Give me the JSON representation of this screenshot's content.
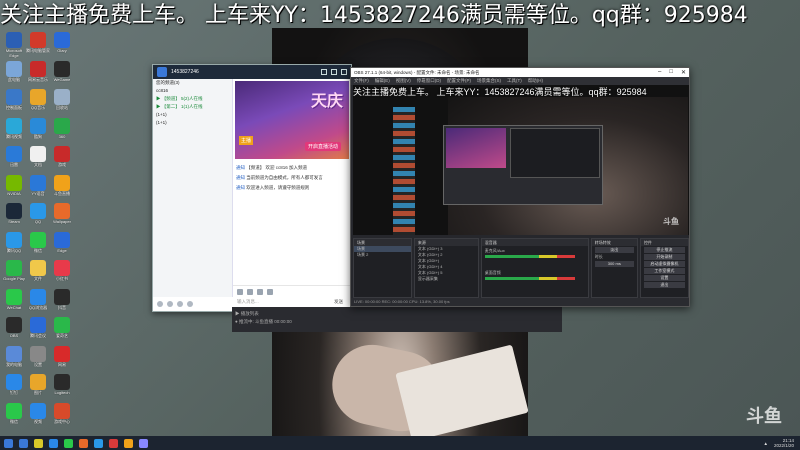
{
  "ticker": {
    "text": "关注主播免费上车。 上车来YY：1453827246满员需等位。qq群：925984"
  },
  "desktop_icons": [
    {
      "label": "Microsoft Edge",
      "color": "#2b5fb4"
    },
    {
      "label": "腾讯电脑管家",
      "color": "#d23a2a"
    },
    {
      "label": "Glary",
      "color": "#2a6ad8"
    },
    {
      "label": "此电脑",
      "color": "#7ba6d8"
    },
    {
      "label": "网易云音乐",
      "color": "#c82a2a"
    },
    {
      "label": "WeGame",
      "color": "#2a2a2a"
    },
    {
      "label": "控制面板",
      "color": "#3a78c8"
    },
    {
      "label": "QQ音乐",
      "color": "#e8a62a"
    },
    {
      "label": "回收站",
      "color": "#9ab0c8"
    },
    {
      "label": "腾讯视频",
      "color": "#2aa8d8"
    },
    {
      "label": "酷狗",
      "color": "#2a8ad8"
    },
    {
      "label": "360",
      "color": "#2aa84a"
    },
    {
      "label": "迅雷",
      "color": "#2a7ad8"
    },
    {
      "label": "文档",
      "color": "#f0f0f0"
    },
    {
      "label": "游戏",
      "color": "#c82a2a"
    },
    {
      "label": "NVIDIA",
      "color": "#76b900"
    },
    {
      "label": "YY语音",
      "color": "#2a78d8"
    },
    {
      "label": "斗鱼直播",
      "color": "#f0a21a"
    },
    {
      "label": "Steam",
      "color": "#1b2838"
    },
    {
      "label": "QQ",
      "color": "#2a98e8"
    },
    {
      "label": "Wallpaper",
      "color": "#e86a2a"
    },
    {
      "label": "腾讯QQ",
      "color": "#2a98e8"
    },
    {
      "label": "微信",
      "color": "#2ac84a"
    },
    {
      "label": "Edge",
      "color": "#2a6ad8"
    },
    {
      "label": "Google Play",
      "color": "#2ab84a"
    },
    {
      "label": "文件",
      "color": "#f0c84a"
    },
    {
      "label": "小红书",
      "color": "#e83a4a"
    },
    {
      "label": "WeChat",
      "color": "#2ac84a"
    },
    {
      "label": "QQ浏览器",
      "color": "#2a88e8"
    },
    {
      "label": "抖音",
      "color": "#2a2a2a"
    },
    {
      "label": "OBS",
      "color": "#2a2a2a"
    },
    {
      "label": "腾讯会议",
      "color": "#2a6ad8"
    },
    {
      "label": "爱奇艺",
      "color": "#2ab84a"
    },
    {
      "label": "我的电脑",
      "color": "#5a8ad8"
    },
    {
      "label": "设置",
      "color": "#888888"
    },
    {
      "label": "网易",
      "color": "#d82a2a"
    },
    {
      "label": "钉钉",
      "color": "#2a88e8"
    },
    {
      "label": "图片",
      "color": "#e8a62a"
    },
    {
      "label": "Logitech",
      "color": "#2a2a2a"
    },
    {
      "label": "微信",
      "color": "#2ac84a"
    },
    {
      "label": "视频",
      "color": "#2a88e8"
    },
    {
      "label": "游戏中心",
      "color": "#d84a2a"
    }
  ],
  "chat_window": {
    "title_id": "1453827246",
    "side_rows": [
      {
        "text": "您的频道(3)",
        "green": false
      },
      {
        "text": "cc816",
        "green": false
      },
      {
        "text": "▶ 【频道】 5(2)人在线",
        "green": true
      },
      {
        "text": "▶ 【第二】 1(1)人在线",
        "green": true
      },
      {
        "text": "(1+1)",
        "green": false
      },
      {
        "text": "(1+1)",
        "green": false
      }
    ],
    "banner_title": "天庆",
    "banner_tag": "主播",
    "banner_sub": "开启直播活动",
    "messages": [
      {
        "prefix": "通知",
        "text": " 【频道】 欢迎 cc816 加入频道"
      },
      {
        "prefix": "通知",
        "text": " 当前频道为自由模式，所有人都可发言"
      },
      {
        "prefix": "通知",
        "text": " 欢迎进入频道，请遵守频道规则"
      }
    ],
    "input_placeholder": "输入消息...",
    "send_label": "发送"
  },
  "obs": {
    "title": "OBS 27.1.1 (64-bit, windows) - 配置文件: 未命名 - 场景: 未命名",
    "menu": [
      "文件(F)",
      "编辑(E)",
      "视图(V)",
      "停靠窗口(D)",
      "配置文件(P)",
      "场景集合(S)",
      "工具(T)",
      "帮助(H)"
    ],
    "preview_text": "关注主播免费上车。 上车来YY：1453827246满员需等位。qq群：925984",
    "preview_wm": "斗鱼",
    "scenes_header": "场景",
    "scenes": [
      "场景",
      "场景 2"
    ],
    "sources_header": "来源",
    "sources": [
      "文本 (GDI+) 3",
      "文本 (GDI+) 2",
      "文本 (GDI+)",
      "文本 (GDI+) 4",
      "文本 (GDI+) 5",
      "显示器采集"
    ],
    "mixer_header": "混音器",
    "mixer": [
      "麦克风/Aux",
      "桌面音频"
    ],
    "transitions_header": "转场特效",
    "transition_value": "淡出",
    "duration_label": "时长",
    "duration_value": "300 ms",
    "controls_header": "控件",
    "controls": [
      "停止推流",
      "开始录制",
      "启动虚拟摄像机",
      "工作室模式",
      "设置",
      "退出"
    ],
    "status": "LIVE: 00:00:00  REC: 00:00:00  CPU: 13.8%, 30.00 fps"
  },
  "dock_strip": {
    "line1": "▶ 播放列表",
    "line2": "● 推流中: 斗鱼直播 00:00:00"
  },
  "taskbar": {
    "icons": [
      "#3a78d8",
      "#d8c82a",
      "#2a88e8",
      "#2ac84a",
      "#e86a2a",
      "#2a98e8",
      "#d83a3a",
      "#f0a21a",
      "#8888ff"
    ],
    "time": "21:14",
    "date": "2022/1/20"
  },
  "watermark": "斗鱼"
}
